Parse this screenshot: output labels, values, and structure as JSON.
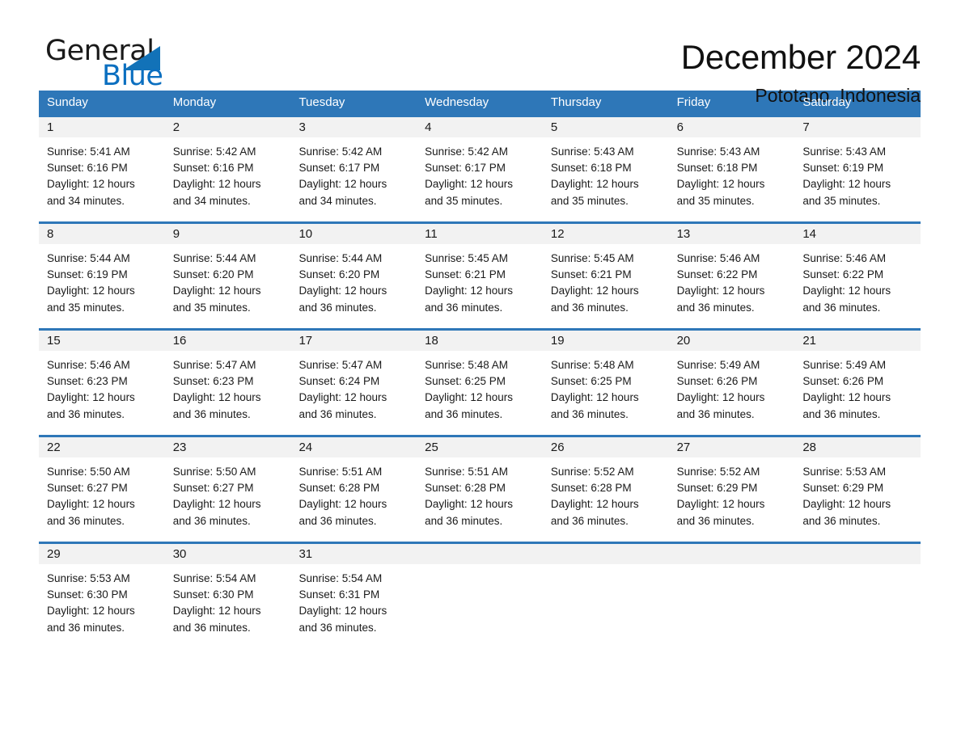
{
  "brand": {
    "name_part1": "General",
    "name_part2": "Blue",
    "accent_color": "#0b6fc0",
    "triangle_color": "#1272b8"
  },
  "header": {
    "month_title": "December 2024",
    "location": "Pototano, Indonesia",
    "header_bg": "#2e77b8",
    "day_band_bg": "#f2f2f2"
  },
  "weekdays": [
    "Sunday",
    "Monday",
    "Tuesday",
    "Wednesday",
    "Thursday",
    "Friday",
    "Saturday"
  ],
  "labels": {
    "sunrise_prefix": "Sunrise:",
    "sunset_prefix": "Sunset:",
    "daylight_prefix": "Daylight:"
  },
  "weeks": [
    [
      {
        "day": "1",
        "sunrise": "Sunrise: 5:41 AM",
        "sunset": "Sunset: 6:16 PM",
        "daylight_line1": "Daylight: 12 hours",
        "daylight_line2": "and 34 minutes."
      },
      {
        "day": "2",
        "sunrise": "Sunrise: 5:42 AM",
        "sunset": "Sunset: 6:16 PM",
        "daylight_line1": "Daylight: 12 hours",
        "daylight_line2": "and 34 minutes."
      },
      {
        "day": "3",
        "sunrise": "Sunrise: 5:42 AM",
        "sunset": "Sunset: 6:17 PM",
        "daylight_line1": "Daylight: 12 hours",
        "daylight_line2": "and 34 minutes."
      },
      {
        "day": "4",
        "sunrise": "Sunrise: 5:42 AM",
        "sunset": "Sunset: 6:17 PM",
        "daylight_line1": "Daylight: 12 hours",
        "daylight_line2": "and 35 minutes."
      },
      {
        "day": "5",
        "sunrise": "Sunrise: 5:43 AM",
        "sunset": "Sunset: 6:18 PM",
        "daylight_line1": "Daylight: 12 hours",
        "daylight_line2": "and 35 minutes."
      },
      {
        "day": "6",
        "sunrise": "Sunrise: 5:43 AM",
        "sunset": "Sunset: 6:18 PM",
        "daylight_line1": "Daylight: 12 hours",
        "daylight_line2": "and 35 minutes."
      },
      {
        "day": "7",
        "sunrise": "Sunrise: 5:43 AM",
        "sunset": "Sunset: 6:19 PM",
        "daylight_line1": "Daylight: 12 hours",
        "daylight_line2": "and 35 minutes."
      }
    ],
    [
      {
        "day": "8",
        "sunrise": "Sunrise: 5:44 AM",
        "sunset": "Sunset: 6:19 PM",
        "daylight_line1": "Daylight: 12 hours",
        "daylight_line2": "and 35 minutes."
      },
      {
        "day": "9",
        "sunrise": "Sunrise: 5:44 AM",
        "sunset": "Sunset: 6:20 PM",
        "daylight_line1": "Daylight: 12 hours",
        "daylight_line2": "and 35 minutes."
      },
      {
        "day": "10",
        "sunrise": "Sunrise: 5:44 AM",
        "sunset": "Sunset: 6:20 PM",
        "daylight_line1": "Daylight: 12 hours",
        "daylight_line2": "and 36 minutes."
      },
      {
        "day": "11",
        "sunrise": "Sunrise: 5:45 AM",
        "sunset": "Sunset: 6:21 PM",
        "daylight_line1": "Daylight: 12 hours",
        "daylight_line2": "and 36 minutes."
      },
      {
        "day": "12",
        "sunrise": "Sunrise: 5:45 AM",
        "sunset": "Sunset: 6:21 PM",
        "daylight_line1": "Daylight: 12 hours",
        "daylight_line2": "and 36 minutes."
      },
      {
        "day": "13",
        "sunrise": "Sunrise: 5:46 AM",
        "sunset": "Sunset: 6:22 PM",
        "daylight_line1": "Daylight: 12 hours",
        "daylight_line2": "and 36 minutes."
      },
      {
        "day": "14",
        "sunrise": "Sunrise: 5:46 AM",
        "sunset": "Sunset: 6:22 PM",
        "daylight_line1": "Daylight: 12 hours",
        "daylight_line2": "and 36 minutes."
      }
    ],
    [
      {
        "day": "15",
        "sunrise": "Sunrise: 5:46 AM",
        "sunset": "Sunset: 6:23 PM",
        "daylight_line1": "Daylight: 12 hours",
        "daylight_line2": "and 36 minutes."
      },
      {
        "day": "16",
        "sunrise": "Sunrise: 5:47 AM",
        "sunset": "Sunset: 6:23 PM",
        "daylight_line1": "Daylight: 12 hours",
        "daylight_line2": "and 36 minutes."
      },
      {
        "day": "17",
        "sunrise": "Sunrise: 5:47 AM",
        "sunset": "Sunset: 6:24 PM",
        "daylight_line1": "Daylight: 12 hours",
        "daylight_line2": "and 36 minutes."
      },
      {
        "day": "18",
        "sunrise": "Sunrise: 5:48 AM",
        "sunset": "Sunset: 6:25 PM",
        "daylight_line1": "Daylight: 12 hours",
        "daylight_line2": "and 36 minutes."
      },
      {
        "day": "19",
        "sunrise": "Sunrise: 5:48 AM",
        "sunset": "Sunset: 6:25 PM",
        "daylight_line1": "Daylight: 12 hours",
        "daylight_line2": "and 36 minutes."
      },
      {
        "day": "20",
        "sunrise": "Sunrise: 5:49 AM",
        "sunset": "Sunset: 6:26 PM",
        "daylight_line1": "Daylight: 12 hours",
        "daylight_line2": "and 36 minutes."
      },
      {
        "day": "21",
        "sunrise": "Sunrise: 5:49 AM",
        "sunset": "Sunset: 6:26 PM",
        "daylight_line1": "Daylight: 12 hours",
        "daylight_line2": "and 36 minutes."
      }
    ],
    [
      {
        "day": "22",
        "sunrise": "Sunrise: 5:50 AM",
        "sunset": "Sunset: 6:27 PM",
        "daylight_line1": "Daylight: 12 hours",
        "daylight_line2": "and 36 minutes."
      },
      {
        "day": "23",
        "sunrise": "Sunrise: 5:50 AM",
        "sunset": "Sunset: 6:27 PM",
        "daylight_line1": "Daylight: 12 hours",
        "daylight_line2": "and 36 minutes."
      },
      {
        "day": "24",
        "sunrise": "Sunrise: 5:51 AM",
        "sunset": "Sunset: 6:28 PM",
        "daylight_line1": "Daylight: 12 hours",
        "daylight_line2": "and 36 minutes."
      },
      {
        "day": "25",
        "sunrise": "Sunrise: 5:51 AM",
        "sunset": "Sunset: 6:28 PM",
        "daylight_line1": "Daylight: 12 hours",
        "daylight_line2": "and 36 minutes."
      },
      {
        "day": "26",
        "sunrise": "Sunrise: 5:52 AM",
        "sunset": "Sunset: 6:28 PM",
        "daylight_line1": "Daylight: 12 hours",
        "daylight_line2": "and 36 minutes."
      },
      {
        "day": "27",
        "sunrise": "Sunrise: 5:52 AM",
        "sunset": "Sunset: 6:29 PM",
        "daylight_line1": "Daylight: 12 hours",
        "daylight_line2": "and 36 minutes."
      },
      {
        "day": "28",
        "sunrise": "Sunrise: 5:53 AM",
        "sunset": "Sunset: 6:29 PM",
        "daylight_line1": "Daylight: 12 hours",
        "daylight_line2": "and 36 minutes."
      }
    ],
    [
      {
        "day": "29",
        "sunrise": "Sunrise: 5:53 AM",
        "sunset": "Sunset: 6:30 PM",
        "daylight_line1": "Daylight: 12 hours",
        "daylight_line2": "and 36 minutes."
      },
      {
        "day": "30",
        "sunrise": "Sunrise: 5:54 AM",
        "sunset": "Sunset: 6:30 PM",
        "daylight_line1": "Daylight: 12 hours",
        "daylight_line2": "and 36 minutes."
      },
      {
        "day": "31",
        "sunrise": "Sunrise: 5:54 AM",
        "sunset": "Sunset: 6:31 PM",
        "daylight_line1": "Daylight: 12 hours",
        "daylight_line2": "and 36 minutes."
      },
      {
        "day": "",
        "sunrise": "",
        "sunset": "",
        "daylight_line1": "",
        "daylight_line2": ""
      },
      {
        "day": "",
        "sunrise": "",
        "sunset": "",
        "daylight_line1": "",
        "daylight_line2": ""
      },
      {
        "day": "",
        "sunrise": "",
        "sunset": "",
        "daylight_line1": "",
        "daylight_line2": ""
      },
      {
        "day": "",
        "sunrise": "",
        "sunset": "",
        "daylight_line1": "",
        "daylight_line2": ""
      }
    ]
  ]
}
